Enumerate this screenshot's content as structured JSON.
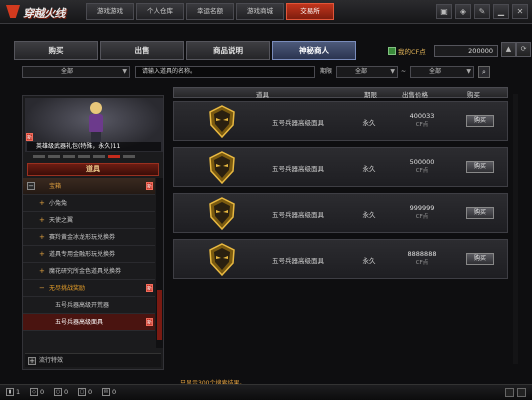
{
  "app": {
    "logo_text": "穿越火线",
    "nav_tabs": [
      "游戏游戏",
      "个人仓库",
      "幸运名额",
      "游戏商城",
      "交易所"
    ],
    "active_nav": 4
  },
  "top_icons": [
    "box-icon",
    "shield-icon",
    "wrench-icon",
    "minimize-icon",
    "close-icon"
  ],
  "subtabs": [
    "购买",
    "出售",
    "商品说明",
    "神秘商人"
  ],
  "active_subtab": 3,
  "cpoints": {
    "label": "我的CF点",
    "value": "200000"
  },
  "filters": {
    "category": "全部",
    "search_placeholder": "请输入道具的名称。",
    "period_label": "期限",
    "period_from": "全部",
    "tilde": "~",
    "period_to": "全部"
  },
  "preview": {
    "caption": "英雄级武器礼包(特殊，永久)11",
    "badge": "新"
  },
  "left_header": "道具",
  "tree": [
    {
      "type": "cat",
      "label": "宝箱",
      "badge": "新"
    },
    {
      "type": "sub",
      "label": "小兔兔"
    },
    {
      "type": "sub",
      "label": "天使之翼"
    },
    {
      "type": "sub",
      "label": "赛羚黄金冰龙形玩兑换券"
    },
    {
      "type": "sub",
      "label": "道具专用金融形玩兑换券"
    },
    {
      "type": "sub",
      "label": "魔花研究所金色道具兑换券"
    },
    {
      "type": "orange",
      "label": "无尽挑战奖励",
      "badge": "新"
    },
    {
      "type": "leaf",
      "label": "五号兵器高级开荒器"
    },
    {
      "type": "leafsel",
      "label": "五号兵器高级面具",
      "badge": "新"
    }
  ],
  "bottom_item": "流行特效",
  "table": {
    "headers": {
      "item": "道具",
      "period": "期限",
      "price": "出售价格",
      "buy": "购买"
    },
    "rows": [
      {
        "name": "五号兵器高级面具",
        "period": "永久",
        "price": "400033",
        "unit": "CF点",
        "buy": "购买"
      },
      {
        "name": "五号兵器高级面具",
        "period": "永久",
        "price": "500000",
        "unit": "CF点",
        "buy": "购买"
      },
      {
        "name": "五号兵器高级面具",
        "period": "永久",
        "price": "999999",
        "unit": "CF点",
        "buy": "购买"
      },
      {
        "name": "五号兵器高级面具",
        "period": "永久",
        "price": "8888888",
        "unit": "CF点",
        "buy": "购买"
      }
    ]
  },
  "footnote": "只显示300个搜索结果。",
  "statusbar": {
    "items": [
      "1",
      "0",
      "0",
      "0",
      "0"
    ]
  }
}
